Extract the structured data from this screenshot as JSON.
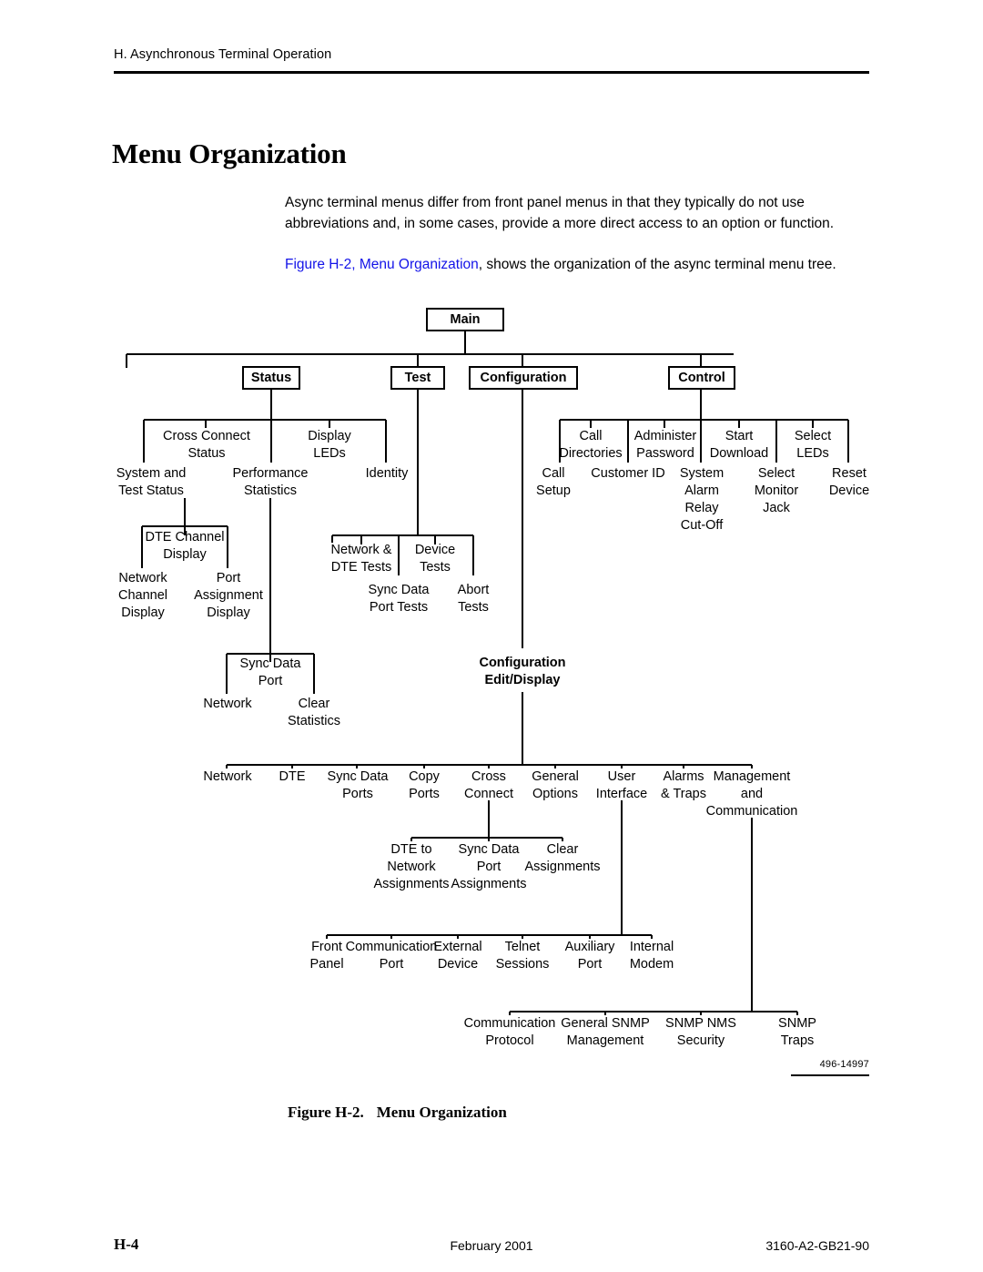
{
  "header": {
    "running_head": "H. Asynchronous Terminal Operation"
  },
  "title": "Menu Organization",
  "paragraphs": {
    "p1": "Async terminal menus differ from front panel menus in that they typically do not use abbreviations and, in some cases, provide a more direct access to an option or function.",
    "p2_link": "Figure H-2, Menu Organization",
    "p2_rest": ", shows the organization of the async terminal menu tree."
  },
  "figure": {
    "id_code": "496-14997",
    "caption_number": "Figure H-2.",
    "caption_title": "Menu Organization"
  },
  "footer": {
    "page": "H-4",
    "date": "February 2001",
    "doc_number": "3160-A2-GB21-90"
  },
  "colors": {
    "link": "#1313e8",
    "ink": "#000000",
    "paper": "#ffffff"
  },
  "diagram": {
    "type": "menu-tree",
    "boxed_nodes": [
      {
        "id": "main",
        "label": "Main"
      },
      {
        "id": "status",
        "label": "Status"
      },
      {
        "id": "test",
        "label": "Test"
      },
      {
        "id": "configuration",
        "label": "Configuration"
      },
      {
        "id": "control",
        "label": "Control"
      }
    ],
    "nodes": [
      {
        "id": "system-and-test-status",
        "lines": [
          "System and",
          "Test Status"
        ]
      },
      {
        "id": "cross-connect-status",
        "lines": [
          "Cross Connect",
          "Status"
        ]
      },
      {
        "id": "performance-statistics",
        "lines": [
          "Performance",
          "Statistics"
        ]
      },
      {
        "id": "display-leds",
        "lines": [
          "Display",
          "LEDs"
        ]
      },
      {
        "id": "identity",
        "lines": [
          "Identity"
        ]
      },
      {
        "id": "network-channel-display",
        "lines": [
          "Network",
          "Channel",
          "Display"
        ]
      },
      {
        "id": "dte-channel-display",
        "lines": [
          "DTE Channel",
          "Display"
        ]
      },
      {
        "id": "port-assignment-display",
        "lines": [
          "Port",
          "Assignment",
          "Display"
        ]
      },
      {
        "id": "network",
        "lines": [
          "Network"
        ]
      },
      {
        "id": "sync-data-port",
        "lines": [
          "Sync Data",
          "Port"
        ]
      },
      {
        "id": "clear-statistics",
        "lines": [
          "Clear",
          "Statistics"
        ]
      },
      {
        "id": "network-and-dte-tests",
        "lines": [
          "Network &",
          "DTE Tests"
        ]
      },
      {
        "id": "sync-data-port-tests",
        "lines": [
          "Sync Data",
          "Port Tests"
        ]
      },
      {
        "id": "device-tests",
        "lines": [
          "Device",
          "Tests"
        ]
      },
      {
        "id": "abort-tests",
        "lines": [
          "Abort",
          "Tests"
        ]
      },
      {
        "id": "call-setup",
        "lines": [
          "Call",
          "Setup"
        ]
      },
      {
        "id": "call-directories",
        "lines": [
          "Call",
          "Directories"
        ]
      },
      {
        "id": "customer-id",
        "lines": [
          "Customer ID"
        ]
      },
      {
        "id": "administer-password",
        "lines": [
          "Administer",
          "Password"
        ]
      },
      {
        "id": "system-alarm-relay-cut-off",
        "lines": [
          "System",
          "Alarm",
          "Relay",
          "Cut-Off"
        ]
      },
      {
        "id": "start-download",
        "lines": [
          "Start",
          "Download"
        ]
      },
      {
        "id": "select-monitor-jack",
        "lines": [
          "Select",
          "Monitor",
          "Jack"
        ]
      },
      {
        "id": "select-leds",
        "lines": [
          "Select",
          "LEDs"
        ]
      },
      {
        "id": "reset-device",
        "lines": [
          "Reset",
          "Device"
        ]
      },
      {
        "id": "configuration-edit-display",
        "lines": [
          "Configuration",
          "Edit/Display"
        ],
        "bold": true
      },
      {
        "id": "cfg-network",
        "lines": [
          "Network"
        ]
      },
      {
        "id": "cfg-dte",
        "lines": [
          "DTE"
        ]
      },
      {
        "id": "cfg-sync-data-ports",
        "lines": [
          "Sync Data",
          "Ports"
        ]
      },
      {
        "id": "cfg-copy-ports",
        "lines": [
          "Copy",
          "Ports"
        ]
      },
      {
        "id": "cfg-cross-connect",
        "lines": [
          "Cross",
          "Connect"
        ]
      },
      {
        "id": "cfg-general-options",
        "lines": [
          "General",
          "Options"
        ]
      },
      {
        "id": "cfg-user-interface",
        "lines": [
          "User",
          "Interface"
        ]
      },
      {
        "id": "cfg-alarms-and-traps",
        "lines": [
          "Alarms",
          "& Traps"
        ]
      },
      {
        "id": "cfg-management-and-communication",
        "lines": [
          "Management",
          "and",
          "Communication"
        ]
      },
      {
        "id": "dte-to-network-assignments",
        "lines": [
          "DTE to",
          "Network",
          "Assignments"
        ]
      },
      {
        "id": "sync-data-port-assignments",
        "lines": [
          "Sync Data",
          "Port",
          "Assignments"
        ]
      },
      {
        "id": "clear-assignments",
        "lines": [
          "Clear",
          "Assignments"
        ]
      },
      {
        "id": "front-panel",
        "lines": [
          "Front",
          "Panel"
        ]
      },
      {
        "id": "communication-port",
        "lines": [
          "Communication",
          "Port"
        ]
      },
      {
        "id": "external-device",
        "lines": [
          "External",
          "Device"
        ]
      },
      {
        "id": "telnet-sessions",
        "lines": [
          "Telnet",
          "Sessions"
        ]
      },
      {
        "id": "auxiliary-port",
        "lines": [
          "Auxiliary",
          "Port"
        ]
      },
      {
        "id": "internal-modem",
        "lines": [
          "Internal",
          "Modem"
        ]
      },
      {
        "id": "communication-protocol",
        "lines": [
          "Communication",
          "Protocol"
        ]
      },
      {
        "id": "general-snmp-management",
        "lines": [
          "General SNMP",
          "Management"
        ]
      },
      {
        "id": "snmp-nms-security",
        "lines": [
          "SNMP NMS",
          "Security"
        ]
      },
      {
        "id": "snmp-traps",
        "lines": [
          "SNMP",
          "Traps"
        ]
      }
    ]
  }
}
